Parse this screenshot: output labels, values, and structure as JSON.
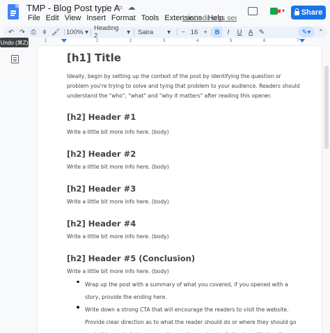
{
  "doc": {
    "title": "TMP - Blog Post type A",
    "last_edit": "Last edit was secon..."
  },
  "menu": [
    "File",
    "Edit",
    "View",
    "Insert",
    "Format",
    "Tools",
    "Extensions",
    "Help"
  ],
  "share_label": "Share",
  "toolbar": {
    "zoom": "100%",
    "style": "Heading 2",
    "font": "Saira",
    "font_size": "16",
    "bold": "B",
    "italic": "I",
    "underline": "U",
    "text_color": "A"
  },
  "tooltip": "Undo (⌘Z)",
  "ruler_marks": [
    "1",
    "1",
    "2",
    "3",
    "4",
    "5",
    "6",
    "7"
  ],
  "content": {
    "title": "[h1] Title",
    "intro": "Ideally, begin by setting up the context of the post by identifying the question or problem you're trying to solve and tying that problem to your audience. Readers should understand the \"who\", \"what\" and \"why it matters\" after reading this opener.",
    "sections": [
      {
        "heading": "[h2] Header #1",
        "body": "Write a little bit more info here. (body)"
      },
      {
        "heading": "[h2] Header #2",
        "body": "Write a little bit more info here. (body)"
      },
      {
        "heading": "[h2] Header #3",
        "body": "Write a little bit more info here. (body)"
      },
      {
        "heading": "[h2] Header #4",
        "body": "Write a little bit more info here. (body)"
      },
      {
        "heading": "[h2] Header #5 (Conclusion)",
        "body": "Write a little bit more info here. (body)"
      }
    ],
    "bullets": [
      "Wrap up the post with a summary of what you covered, if you opened with a story, provide the ending here.",
      "Write down a strong CTA that will encourage the readers to visit the website. Provide clear direction as to what the reader should do or where they should go next, this can include commenting on the post or invitation to call/subscribe."
    ]
  }
}
